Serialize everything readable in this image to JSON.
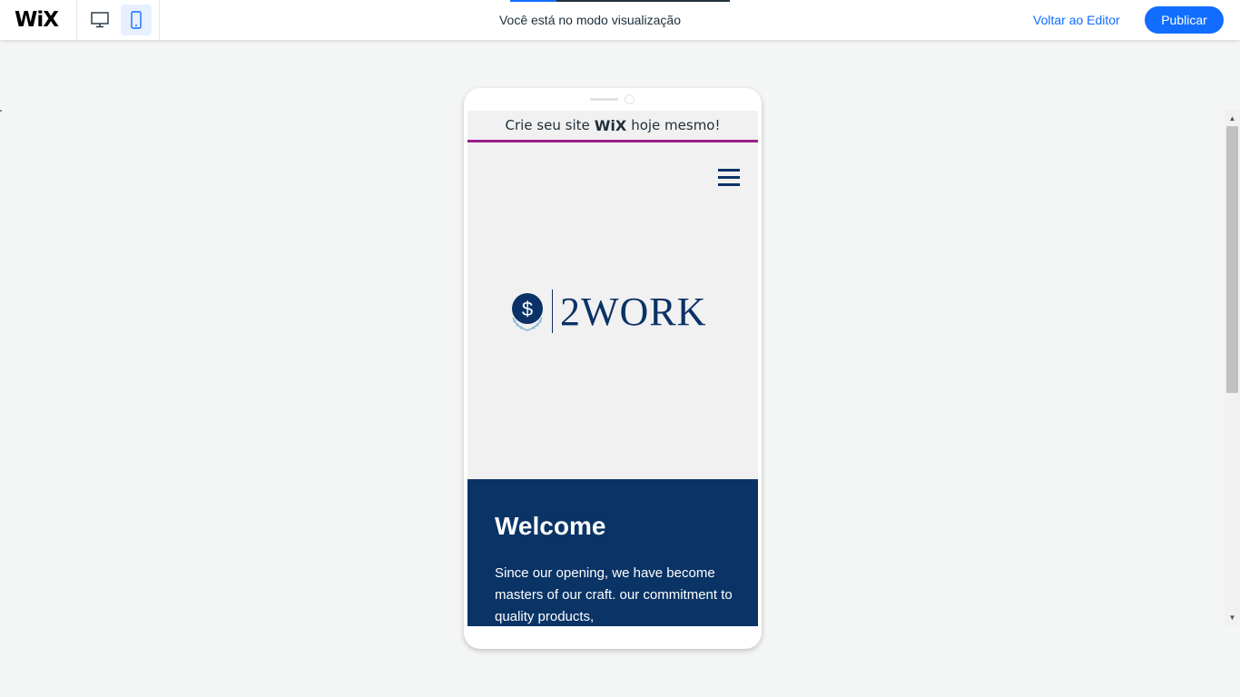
{
  "topbar": {
    "logo": "WiX",
    "mode_text": "Você está no modo visualização",
    "back_link": "Voltar ao Editor",
    "publish_label": "Publicar",
    "progress": 0.21,
    "desktop_icon": "desktop-icon",
    "mobile_icon": "mobile-icon"
  },
  "preview": {
    "banner": {
      "prefix": "Crie seu site",
      "brand": "WiX",
      "suffix": "hoje mesmo!"
    },
    "logo_text": "2WORK",
    "logo_symbol": "$",
    "welcome_title": "Welcome",
    "welcome_text": "Since our opening, we have become masters of our craft. our commitment to quality products,"
  },
  "colors": {
    "accent": "#116dff",
    "banner_line": "#9a1f8c",
    "brand_navy": "#0a3466"
  }
}
